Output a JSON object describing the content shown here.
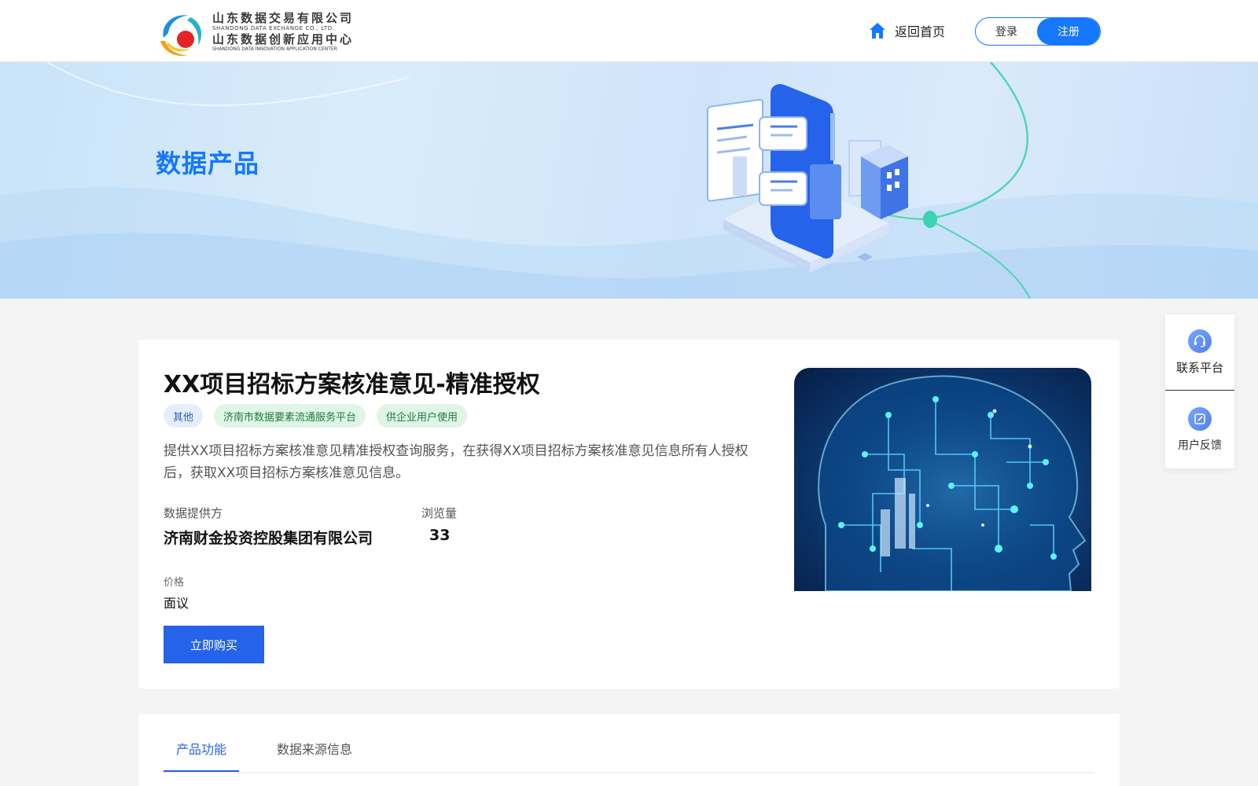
{
  "header": {
    "logo": {
      "line1": "山东数据交易有限公司",
      "line2": "SHANDONG DATA EXCHANGE CO., LTD.",
      "line3": "山东数据创新应用中心",
      "line4": "SHANDONG DATA INNOVATION APPLICATION CENTER"
    },
    "home_label": "返回首页",
    "login_label": "登录",
    "register_label": "注册"
  },
  "banner": {
    "title": "数据产品"
  },
  "side_panel": {
    "contact_label": "联系平台",
    "feedback_label": "用户反馈"
  },
  "product": {
    "title": "XX项目招标方案核准意见-精准授权",
    "tags": [
      "其他",
      "济南市数据要素流通服务平台",
      "供企业用户使用"
    ],
    "description": "提供XX项目招标方案核准意见精准授权查询服务，在获得XX项目招标方案核准意见信息所有人授权后，获取XX项目招标方案核准意见信息。",
    "provider_label": "数据提供方",
    "provider_value": "济南财金投资控股集团有限公司",
    "views_label": "浏览量",
    "views_value": "33",
    "price_label": "价格",
    "price_value": "面议",
    "buy_label": "立即购买"
  },
  "tabs": {
    "items": [
      "产品功能",
      "数据来源信息"
    ],
    "active": "产品功能"
  },
  "colors": {
    "brand": "#1677ff",
    "button": "#2563eb",
    "tag_blue_bg": "#e6eefb",
    "tag_green_bg": "#dff5e6"
  }
}
